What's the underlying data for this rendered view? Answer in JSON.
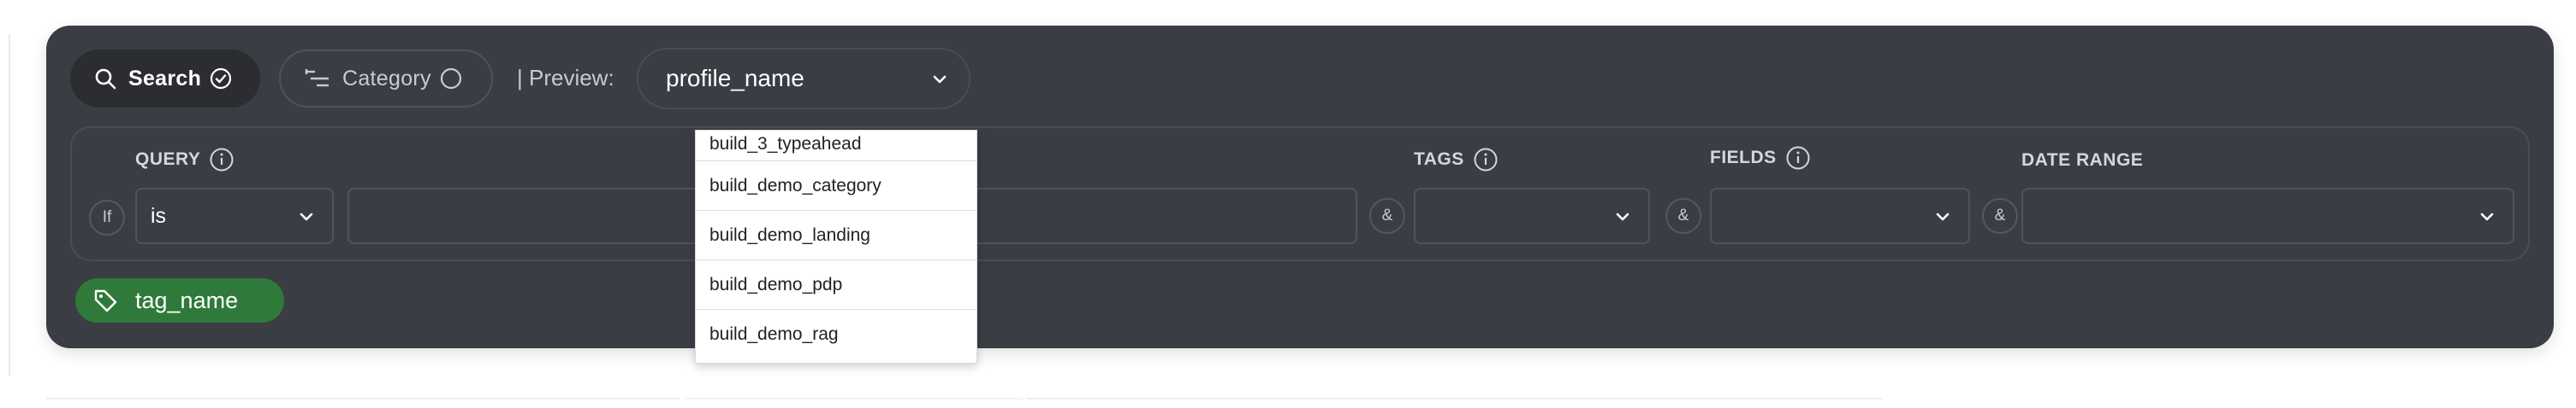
{
  "toolbar": {
    "search_label": "Search",
    "category_label": "Category",
    "preview_label": "| Preview:",
    "preview_value": "profile_name"
  },
  "query": {
    "label": "QUERY",
    "condition_prefix": "If",
    "operator_value": "is",
    "value_input": "",
    "and_symbol": "&"
  },
  "tags": {
    "label": "TAGS",
    "value": ""
  },
  "fields": {
    "label": "FIELDS",
    "value": ""
  },
  "date_range": {
    "label": "DATE RANGE",
    "value": ""
  },
  "tag_chip": {
    "label": "tag_name",
    "color": "#2f7a3a"
  },
  "dropdown": {
    "options": [
      "build_3_typeahead",
      "build_demo_category",
      "build_demo_landing",
      "build_demo_pdp",
      "build_demo_rag"
    ]
  },
  "colors": {
    "panel_bg": "#3a3d43",
    "accent_green": "#2f7a3a"
  },
  "icons": {
    "search": "search-icon",
    "check": "check-circle-icon",
    "category": "filter-lines-icon",
    "radio": "radio-empty-icon",
    "chevron": "chevron-down-icon",
    "info": "info-icon",
    "tag": "tag-icon"
  }
}
